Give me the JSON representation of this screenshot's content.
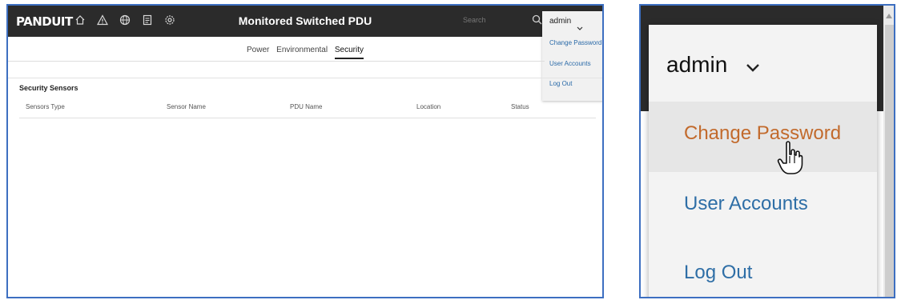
{
  "header": {
    "logo": "PANDUIT",
    "title": "Monitored Switched PDU",
    "search_placeholder": "Search",
    "nav_icons": [
      "home-icon",
      "alert-icon",
      "globe-icon",
      "log-icon",
      "settings-icon"
    ]
  },
  "user_menu": {
    "username": "admin",
    "items": [
      "Change Password",
      "User Accounts",
      "Log Out"
    ],
    "hovered": "Change Password"
  },
  "tabs": [
    "Power",
    "Environmental",
    "Security"
  ],
  "active_tab": "Security",
  "section": {
    "title": "Security Sensors",
    "columns": [
      "Sensors Type",
      "Sensor Name",
      "PDU Name",
      "Location",
      "Status"
    ]
  },
  "colors": {
    "topbar": "#2b2b2b",
    "link": "#2e6ea6",
    "hover_link": "#c26a2c",
    "panel_border": "#3d6fc1"
  }
}
